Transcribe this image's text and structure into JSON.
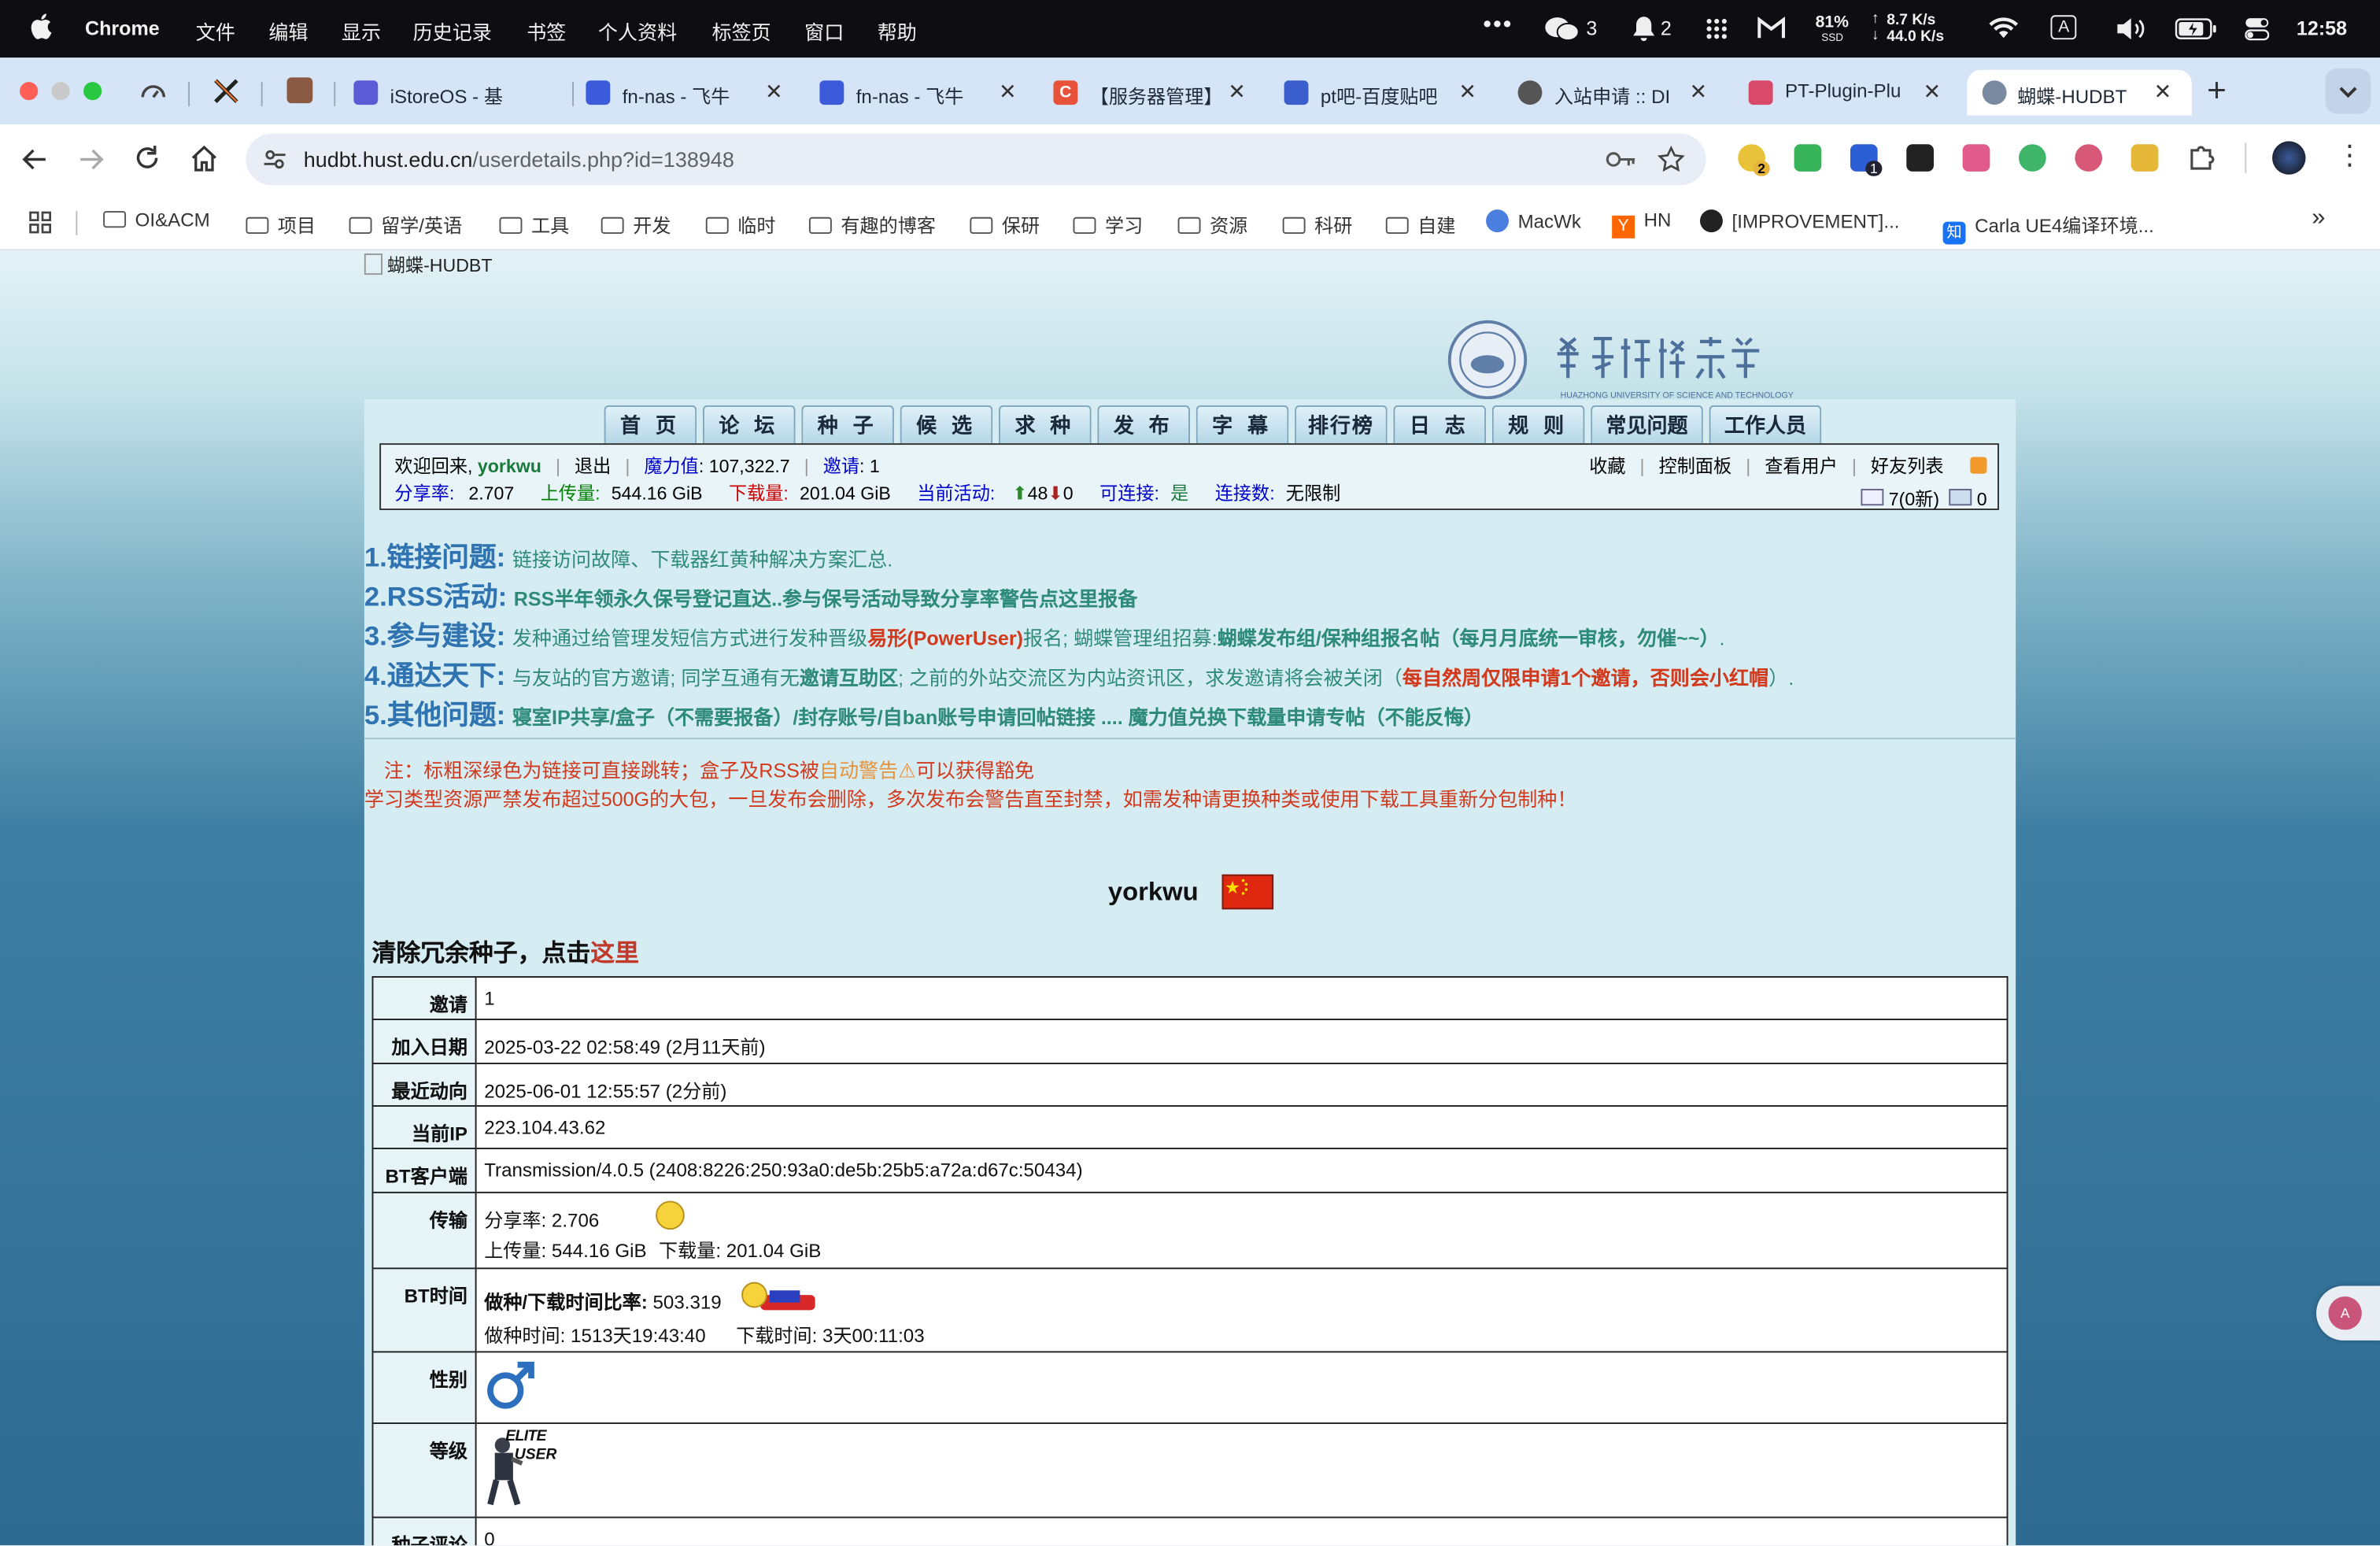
{
  "menubar": {
    "app": "Chrome",
    "menus": [
      "文件",
      "编辑",
      "显示",
      "历史记录",
      "书签",
      "个人资料",
      "标签页",
      "窗口",
      "帮助"
    ],
    "wechat_count": "3",
    "notif_count": "2",
    "battery": "81%",
    "battery_sub": "SSD",
    "net_up": "8.7 K/s",
    "net_down": "44.0 K/s",
    "input_method": "A",
    "time": "12:58"
  },
  "tabs": [
    {
      "title": "iStoreOS - 基"
    },
    {
      "title": "fn-nas - 飞牛"
    },
    {
      "title": "fn-nas - 飞牛"
    },
    {
      "title": "【服务器管理】"
    },
    {
      "title": "pt吧-百度贴吧"
    },
    {
      "title": "入站申请 :: DI"
    },
    {
      "title": "PT-Plugin-Plu"
    },
    {
      "title": "蝴蝶-HUDBT"
    }
  ],
  "address": {
    "host": "hudbt.hust.edu.cn",
    "path": "/userdetails.php?id=138948"
  },
  "extensions": {
    "badge1": "2",
    "badge2": "1"
  },
  "bookmarks": [
    "OI&ACM",
    "项目",
    "留学/英语",
    "工具",
    "开发",
    "临时",
    "有趣的博客",
    "保研",
    "学习",
    "资源",
    "科研",
    "自建",
    "MacWk",
    "HN",
    "[IMPROVEMENT]...",
    "Carla UE4编译环境..."
  ],
  "site": {
    "logo_alt": "蝴蝶-HUDBT",
    "nav": [
      "首 页",
      "论 坛",
      "种 子",
      "候 选",
      "求 种",
      "发 布",
      "字 幕",
      "排行榜",
      "日 志",
      "规 则",
      "常见问题",
      "工作人员"
    ],
    "info": {
      "welcome": "欢迎回来,",
      "user": "yorkwu",
      "logout": "退出",
      "magic_label": "魔力值",
      "magic": ": 107,322.7",
      "invite_label": "邀请",
      "invite": ": 1",
      "fav": "收藏",
      "panel": "控制面板",
      "users": "查看用户",
      "friends": "好友列表",
      "ratio_label": "分享率:",
      "ratio": "2.707",
      "up_label": "上传量:",
      "up": "544.16 GiB",
      "down_label": "下载量:",
      "down": "201.04 GiB",
      "active_label": "当前活动:",
      "active_seed": "48",
      "active_leech": "0",
      "conn_label": "可连接:",
      "conn": "是",
      "conns_label": "连接数:",
      "conns": "无限制",
      "msg": "7(0新)",
      "msg2": "0"
    },
    "notices": [
      {
        "h": "1.链接问题:",
        "t": "链接访问故障、下载器红黄种解决方案汇总."
      },
      {
        "h": "2.RSS活动:",
        "t": "RSS半年领永久保号登记直达..参与保号活动导致分享率警告点这里报备"
      },
      {
        "h": "3.参与建设:",
        "t1": "发种通过给管理发短信方式进行发种晋级",
        "t2": "易形(PowerUser)",
        "t3": "报名; 蝴蝶管理组招募:",
        "t4": "蝴蝶发布组/保种组报名帖（每月月底统一审核，勿催~~）",
        "t5": "."
      },
      {
        "h": "4.通达天下:",
        "t1": "与友站的官方邀请; 同学互通有无",
        "t2": "邀请互助区",
        "t3": "; 之前的外站交流区为内站资讯区，求发邀请将会被关闭（",
        "t4": "每自然周仅限申请1个邀请，否则会小红帽",
        "t5": "）."
      },
      {
        "h": "5.其他问题:",
        "t": "寝室IP共享/盒子（不需要报备）/封存账号/自ban账号申请回帖链接 .... 魔力值兑换下载量申请专帖（不能反悔）"
      }
    ],
    "warn1a": "注：标粗深绿色为链接可直接跳转；盒子及RSS被",
    "warn1b": "自动警告⚠",
    "warn1c": "可以获得豁免",
    "warn2": "学习类型资源严禁发布超过500G的大包，一旦发布会删除，多次发布会警告直至封禁，如需发种请更换种类或使用下载工具重新分包制种！",
    "profile_name": "yorkwu",
    "clean_text": "清除冗余种子，点击",
    "clean_link": "这里",
    "table": {
      "invite_label": "邀请",
      "invite": "1",
      "join_label": "加入日期",
      "join": "2025-03-22 02:58:49 (2月11天前)",
      "last_label": "最近动向",
      "last": "2025-06-01 12:55:57 (2分前)",
      "ip_label": "当前IP",
      "ip": "223.104.43.62",
      "client_label": "BT客户端",
      "client": "Transmission/4.0.5 (2408:8226:250:93a0:de5b:25b5:a72a:d67c:50434)",
      "transfer_label": "传输",
      "t_ratio": "分享率: 2.706",
      "t_up": "上传量: 544.16 GiB",
      "t_down": "下载量: 201.04 GiB",
      "bt_label": "BT时间",
      "bt_ratio_label": "做种/下载时间比率:",
      "bt_ratio": "503.319",
      "seed_time": "做种时间: 1513天19:43:40",
      "dl_time": "下载时间: 3天00:11:03",
      "gender_label": "性别",
      "level_label": "等级",
      "level_line1": "ELITE",
      "level_line2": "USER",
      "comments_label": "种子评论",
      "comments": "0"
    }
  }
}
